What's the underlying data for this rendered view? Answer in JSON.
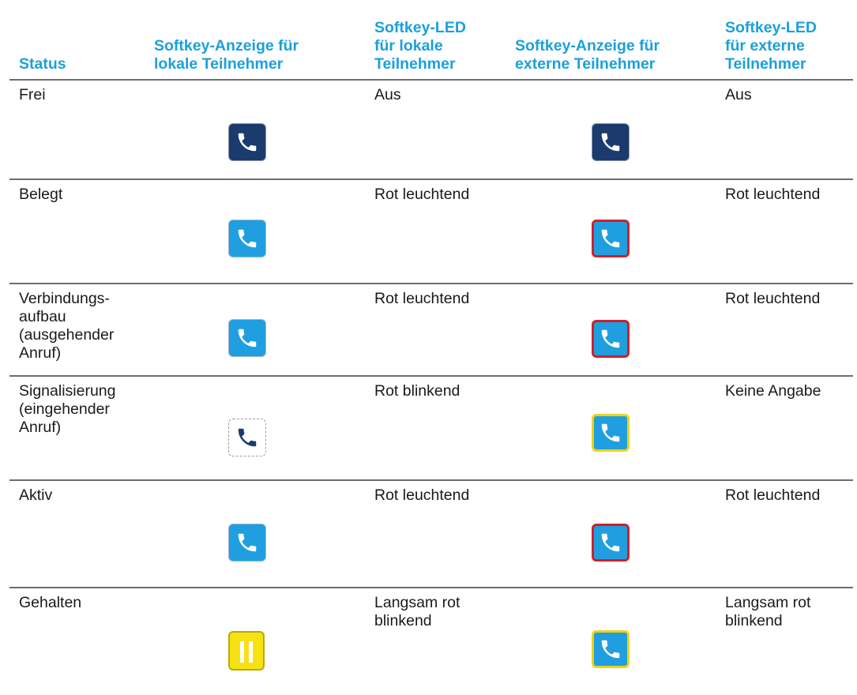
{
  "headers": [
    "Status",
    "Softkey-Anzeige für\nlokale Teilnehmer",
    "Softkey-LED\nfür lokale\nTeilnehmer",
    "Softkey-Anzeige für\nexterne Teilnehmer",
    "Softkey-LED\nfür externe\nTeilnehmer"
  ],
  "rows": [
    {
      "status": "Frei",
      "led_local": "Aus",
      "led_external": "Aus",
      "icon_local": "phone-icon-dark-blue",
      "icon_external": "phone-icon-dark-blue"
    },
    {
      "status": "Belegt",
      "led_local": "Rot leuchtend",
      "led_external": "Rot leuchtend",
      "icon_local": "phone-icon-light-blue",
      "icon_external": "phone-icon-red-border"
    },
    {
      "status": "Verbindungs-\naufbau\n(ausgehender\nAnruf)",
      "led_local": "Rot leuchtend",
      "led_external": "Rot leuchtend",
      "icon_local": "phone-icon-light-blue",
      "icon_external": "phone-icon-red-border"
    },
    {
      "status": "Signalisierung\n(eingehender\nAnruf)",
      "led_local": "Rot blinkend",
      "led_external": "Keine Angabe",
      "icon_local": "phone-icon-white",
      "icon_external": "phone-icon-yellow-border"
    },
    {
      "status": "Aktiv",
      "led_local": "Rot leuchtend",
      "led_external": "Rot leuchtend",
      "icon_local": "phone-icon-light-blue",
      "icon_external": "phone-icon-red-border"
    },
    {
      "status": "Gehalten",
      "led_local": "Langsam rot\nblinkend",
      "led_external": "Langsam rot\nblinkend",
      "icon_local": "hold-icon-yellow",
      "icon_external": "phone-icon-yellow-border"
    }
  ],
  "colors": {
    "header_text": "#1ba0dc",
    "rule": "#6d6d6d",
    "dark_blue": "#1b3b6f",
    "light_blue": "#1f9fe0",
    "red": "#d0202a",
    "yellow": "#f2d216"
  }
}
